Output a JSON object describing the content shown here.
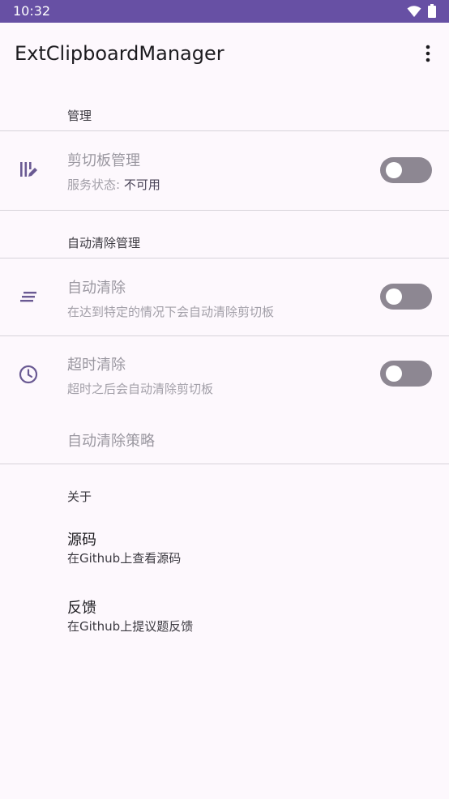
{
  "status_bar": {
    "time": "10:32"
  },
  "app_bar": {
    "title": "ExtClipboardManager"
  },
  "sections": {
    "manage": {
      "header": "管理",
      "clipboard": {
        "title": "剪切板管理",
        "summary_prefix": "服务状态: ",
        "summary_value": "不可用",
        "enabled": false
      }
    },
    "auto_clear": {
      "header": "自动清除管理",
      "auto": {
        "title": "自动清除",
        "summary": "在达到特定的情况下会自动清除剪切板",
        "enabled": false
      },
      "timeout": {
        "title": "超时清除",
        "summary": "超时之后会自动清除剪切板",
        "enabled": false
      },
      "strategy": {
        "title": "自动清除策略"
      }
    },
    "about": {
      "header": "关于",
      "source": {
        "title": "源码",
        "summary": "在Github上查看源码"
      },
      "feedback": {
        "title": "反馈",
        "summary": "在Github上提议题反馈"
      }
    }
  },
  "colors": {
    "accent": "#6750a4",
    "icon": "#6a5a93",
    "switch_track_off": "#8d8792"
  }
}
